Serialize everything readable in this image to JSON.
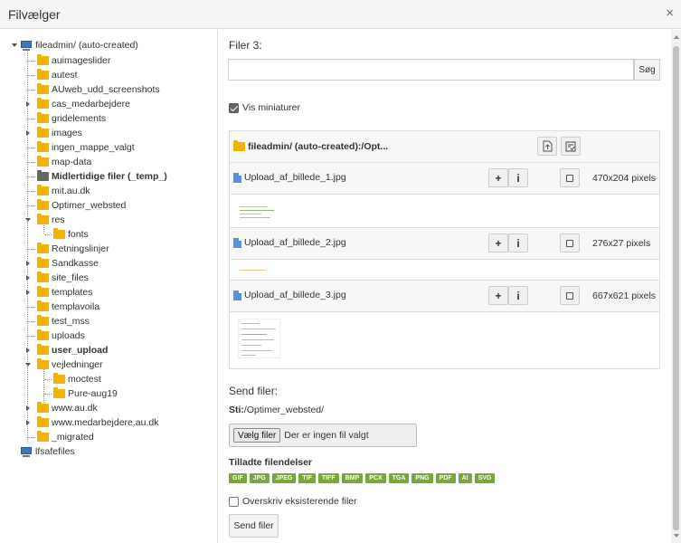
{
  "window": {
    "title": "Filvælger"
  },
  "tree": {
    "root": "fileadmin/ (auto-created)",
    "items": [
      {
        "label": "auimageslider"
      },
      {
        "label": "autest"
      },
      {
        "label": "AUweb_udd_screenshots"
      },
      {
        "label": "cas_medarbejdere"
      },
      {
        "label": "gridelements"
      },
      {
        "label": "images"
      },
      {
        "label": "ingen_mappe_valgt"
      },
      {
        "label": "map-data"
      },
      {
        "label": "Midlertidige filer (_temp_)"
      },
      {
        "label": "mit.au.dk"
      },
      {
        "label": "Optimer_websted"
      },
      {
        "label": "res"
      },
      {
        "label": "fonts"
      },
      {
        "label": "Retningslinjer"
      },
      {
        "label": "Sandkasse"
      },
      {
        "label": "site_files"
      },
      {
        "label": "templates"
      },
      {
        "label": "templavoila"
      },
      {
        "label": "test_mss"
      },
      {
        "label": "uploads"
      },
      {
        "label": "user_upload"
      },
      {
        "label": "vejledninger"
      },
      {
        "label": "moctest"
      },
      {
        "label": "Pure-aug19"
      },
      {
        "label": "www.au.dk"
      },
      {
        "label": "www.medarbejdere.au.dk"
      },
      {
        "label": "_migrated"
      }
    ],
    "second_root": "lfsafefiles"
  },
  "search": {
    "label": "Filer 3:",
    "value": "",
    "button": "Søg"
  },
  "thumbnails_label": "Vis miniaturer",
  "file_list": {
    "folder_path": "fileadmin/ (auto-created):/Opt...",
    "files": [
      {
        "name": "Upload_af_billede_1.jpg",
        "dims": "470x204 pixels"
      },
      {
        "name": "Upload_af_billede_2.jpg",
        "dims": "276x27 pixels"
      },
      {
        "name": "Upload_af_billede_3.jpg",
        "dims": "667x621 pixels"
      }
    ],
    "plus_label": "+",
    "info_label": "i"
  },
  "upload": {
    "heading": "Send filer:",
    "path_label": "Sti:",
    "path_value": "/Optimer_websted/",
    "choose_button": "Vælg filer",
    "no_file_text": "Der er ingen fil valgt",
    "allowed_heading": "Tilladte filendelser",
    "extensions": [
      "GIF",
      "JPG",
      "JPEG",
      "TIF",
      "TIFF",
      "BMP",
      "PCX",
      "TGA",
      "PNG",
      "PDF",
      "AI",
      "SVG"
    ],
    "overwrite_label": "Overskriv eksisterende filer",
    "send_button": "Send filer"
  }
}
